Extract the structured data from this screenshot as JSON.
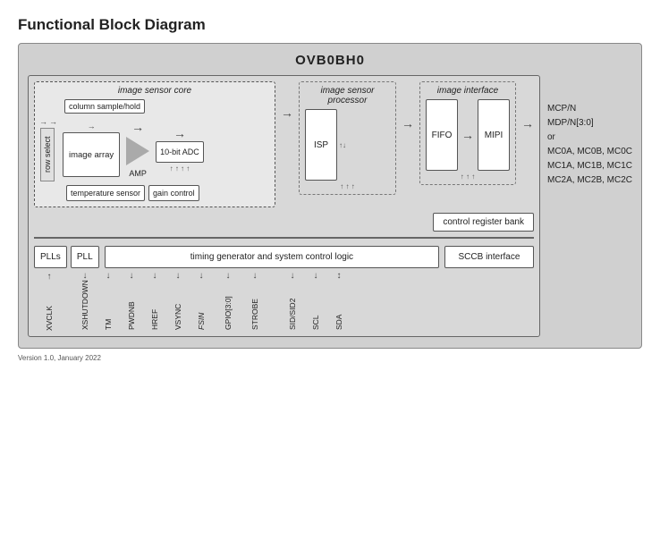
{
  "page": {
    "title": "Functional Block Diagram"
  },
  "diagram": {
    "chip_name": "OVB0BH0",
    "sensor_core_label": "image sensor core",
    "isp_label": "image sensor processor",
    "image_iface_label": "image interface",
    "row_select": "row select",
    "col_sample": "column sample/hold",
    "image_array": "image array",
    "amp_label": "AMP",
    "adc_label": "10-bit ADC",
    "temperature_sensor": "temperature sensor",
    "gain_control": "gain control",
    "isp_box": "ISP",
    "fifo_box": "FIFO",
    "mipi_box": "MIPI",
    "control_register_bank": "control register bank",
    "pll_s_label": "PLLs",
    "pll_label": "PLL",
    "timing_box": "timing generator and system control logic",
    "sccb_box": "SCCB interface",
    "right_labels_line1": "MCP/N",
    "right_labels_line2": "MDP/N[3:0]",
    "right_labels_line3": "or",
    "right_labels_line4": "MC0A, MC0B, MC0C",
    "right_labels_line5": "MC1A, MC1B, MC1C",
    "right_labels_line6": "MC2A, MC2B, MC2C",
    "version": "Version 1.0, January 2022",
    "pins": [
      {
        "label": "XVCLK",
        "italic": false,
        "dir": "up"
      },
      {
        "label": "XSHUTDOWN",
        "italic": false,
        "dir": "down"
      },
      {
        "label": "TM",
        "italic": false,
        "dir": "down"
      },
      {
        "label": "PWDNB",
        "italic": false,
        "dir": "down"
      },
      {
        "label": "HREF",
        "italic": false,
        "dir": "down"
      },
      {
        "label": "VSYNC",
        "italic": false,
        "dir": "down"
      },
      {
        "label": "FSIN",
        "italic": false,
        "dir": "down"
      },
      {
        "label": "GPIO[3:0]",
        "italic": false,
        "dir": "down"
      },
      {
        "label": "STROBE",
        "italic": false,
        "dir": "down"
      },
      {
        "label": "SID/SID2",
        "italic": false,
        "dir": "down"
      },
      {
        "label": "SCL",
        "italic": false,
        "dir": "down"
      },
      {
        "label": "SDA",
        "italic": false,
        "dir": "both"
      }
    ]
  }
}
